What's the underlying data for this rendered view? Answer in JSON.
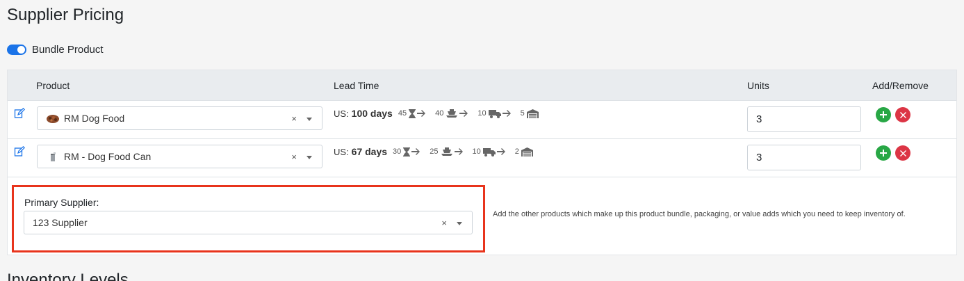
{
  "page": {
    "title": "Supplier Pricing",
    "next_section_title": "Inventory Levels"
  },
  "bundle": {
    "label": "Bundle Product",
    "enabled": true
  },
  "table": {
    "headers": {
      "product": "Product",
      "lead_time": "Lead Time",
      "units": "Units",
      "add_remove": "Add/Remove"
    },
    "rows": [
      {
        "product": "RM Dog Food",
        "lead_prefix": "US:",
        "lead_total": "100 days",
        "lead_steps": [
          "45",
          "40",
          "10",
          "5"
        ],
        "units": "3"
      },
      {
        "product": "RM - Dog Food Can",
        "lead_prefix": "US:",
        "lead_total": "67 days",
        "lead_steps": [
          "30",
          "25",
          "10",
          "2"
        ],
        "units": "3"
      }
    ]
  },
  "supplier": {
    "label": "Primary Supplier:",
    "value": "123 Supplier"
  },
  "help": {
    "text": "Add the other products which make up this product bundle, packaging, or value adds which you need to keep inventory of."
  },
  "colors": {
    "accent": "#1a73e8",
    "add": "#28a745",
    "remove": "#dc3545",
    "highlight": "#e8341c"
  }
}
